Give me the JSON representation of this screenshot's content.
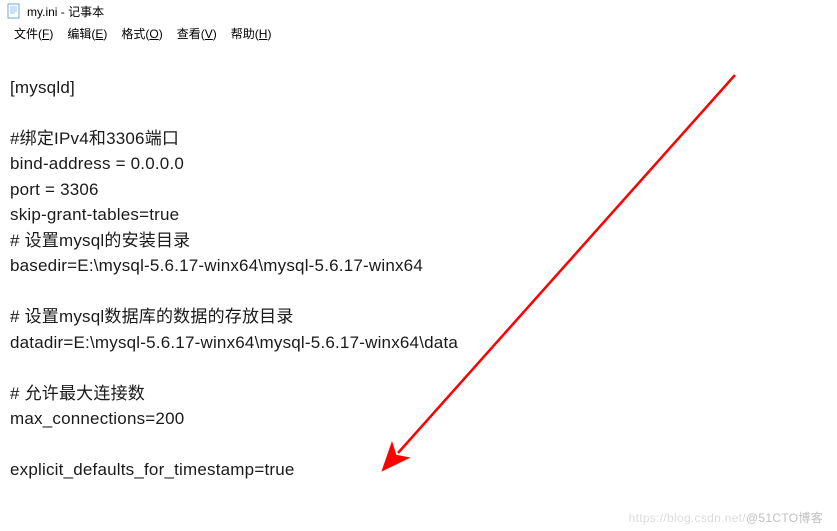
{
  "window": {
    "title": "my.ini - 记事本"
  },
  "menu": {
    "file": "文件",
    "file_hotkey": "F",
    "edit": "编辑",
    "edit_hotkey": "E",
    "format": "格式",
    "format_hotkey": "O",
    "view": "查看",
    "view_hotkey": "V",
    "help": "帮助",
    "help_hotkey": "H"
  },
  "content": {
    "line1": "[mysqld]",
    "line2": "",
    "line3": "#绑定IPv4和3306端口",
    "line4": "bind-address = 0.0.0.0",
    "line5": "port = 3306",
    "line6": "skip-grant-tables=true",
    "line7": "# 设置mysql的安装目录",
    "line8": "basedir=E:\\mysql-5.6.17-winx64\\mysql-5.6.17-winx64",
    "line9": "",
    "line10": "# 设置mysql数据库的数据的存放目录",
    "line11": "datadir=E:\\mysql-5.6.17-winx64\\mysql-5.6.17-winx64\\data",
    "line12": "",
    "line13": "# 允许最大连接数",
    "line14": "max_connections=200",
    "line15": "",
    "line16": "explicit_defaults_for_timestamp=true"
  },
  "watermark": {
    "left": "https://blog.csdn.net/",
    "right": "@51CTO博客"
  },
  "annotation": {
    "arrow_color": "#ff0000"
  }
}
